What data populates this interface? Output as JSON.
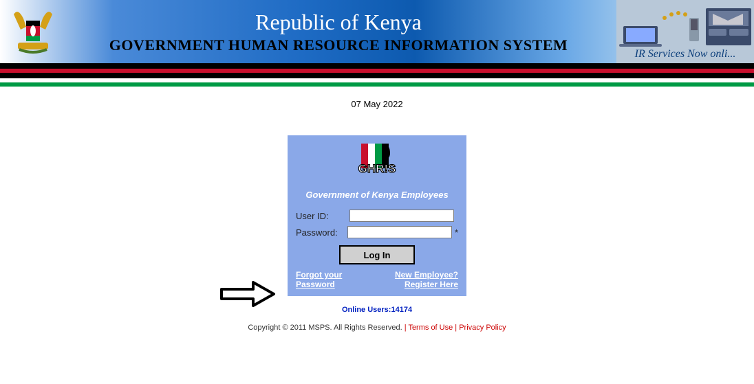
{
  "header": {
    "title_main": "Republic of Kenya",
    "title_sub": "GOVERNMENT HUMAN RESOURCE INFORMATION SYSTEM",
    "right_tagline": "IR Services Now onli..."
  },
  "date": "07 May 2022",
  "login": {
    "logo_text": "GHR!S",
    "subtitle": "Government of Kenya Employees",
    "user_label": "User ID:",
    "user_value": "",
    "password_label": "Password:",
    "password_value": "",
    "login_button": "Log In",
    "forgot_link": "Forgot your Password",
    "register_link": "New Employee? Register Here"
  },
  "online_users": {
    "label": "Online Users:",
    "count": "14174"
  },
  "footer": {
    "copyright": "Copyright © 2011 MSPS. All Rights Reserved.",
    "terms": "Terms of Use",
    "privacy": "Privacy Policy"
  }
}
